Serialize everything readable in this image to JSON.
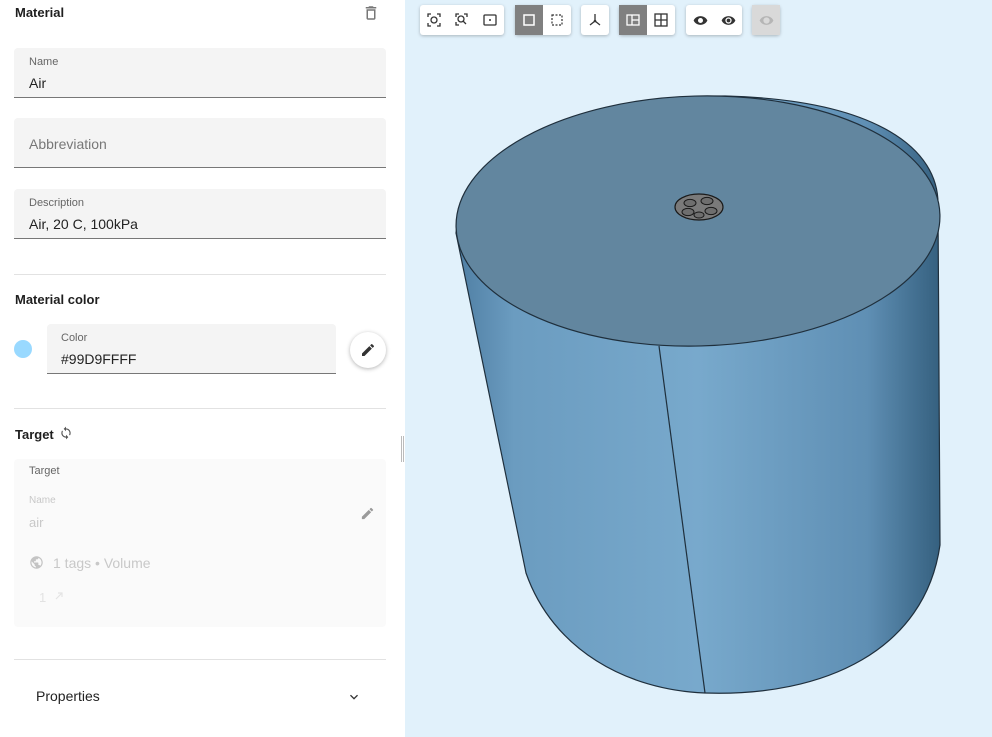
{
  "panel": {
    "section_title": "Material",
    "name": {
      "label": "Name",
      "value": "Air"
    },
    "abbreviation": {
      "placeholder": "Abbreviation"
    },
    "description": {
      "label": "Description",
      "value": "Air, 20 C, 100kPa"
    },
    "material_color": {
      "title": "Material color",
      "color_label": "Color",
      "color_value": "#99D9FFFF",
      "swatch_hex": "#99d9ff"
    },
    "target": {
      "title": "Target",
      "card_title": "Target",
      "name_label": "Name",
      "name_value": "air",
      "tags_text": "1 tags • Volume",
      "count_text": "1"
    },
    "properties": {
      "label": "Properties"
    }
  },
  "viewport": {
    "background": "#e1f1fb",
    "object_color": "#6f9fc0"
  }
}
